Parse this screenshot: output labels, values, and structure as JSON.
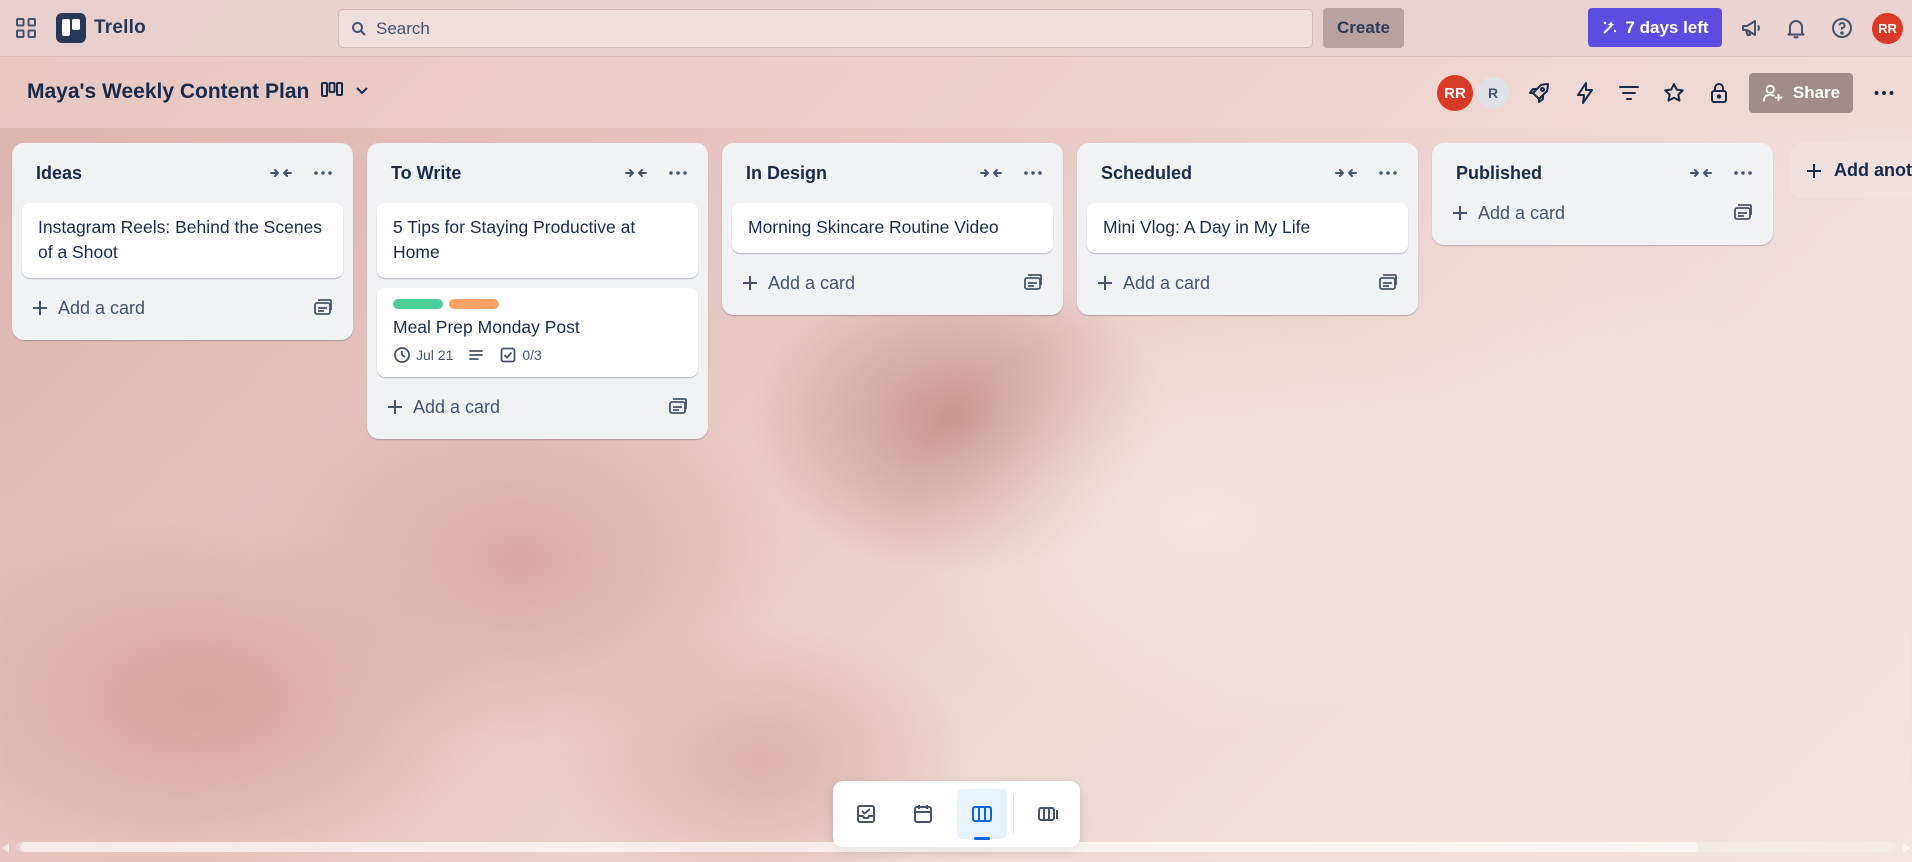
{
  "app": {
    "name": "Trello"
  },
  "colors": {
    "brand": "#253858",
    "trial": "#5c4ce0",
    "avatar": "#d93a26",
    "label_green": "#4bce97",
    "label_orange": "#fea362",
    "active_view": "#0c66e4"
  },
  "topbar": {
    "search_placeholder": "Search",
    "create_label": "Create",
    "trial_label": "7 days left",
    "user_initials": "RR"
  },
  "board": {
    "title": "Maya's Weekly Content Plan",
    "members": [
      "RR",
      "R"
    ],
    "share_label": "Share"
  },
  "lists": [
    {
      "title": "Ideas",
      "cards": [
        {
          "title": "Instagram Reels: Behind the Scenes of a Shoot"
        }
      ],
      "add_card_label": "Add a card"
    },
    {
      "title": "To Write",
      "cards": [
        {
          "title": "5 Tips for Staying Productive at Home"
        },
        {
          "title": "Meal Prep Monday Post",
          "labels": [
            "green",
            "orange"
          ],
          "due": "Jul 21",
          "has_description": true,
          "checklist": "0/3"
        }
      ],
      "add_card_label": "Add a card"
    },
    {
      "title": "In Design",
      "cards": [
        {
          "title": "Morning Skincare Routine Video"
        }
      ],
      "add_card_label": "Add a card"
    },
    {
      "title": "Scheduled",
      "cards": [
        {
          "title": "Mini Vlog: A Day in My Life"
        }
      ],
      "add_card_label": "Add a card"
    },
    {
      "title": "Published",
      "cards": [],
      "add_card_label": "Add a card"
    }
  ],
  "add_list_label": "Add another list",
  "view_switcher": {
    "items": [
      "inbox",
      "planner",
      "board",
      "switch-boards"
    ],
    "active": "board"
  }
}
